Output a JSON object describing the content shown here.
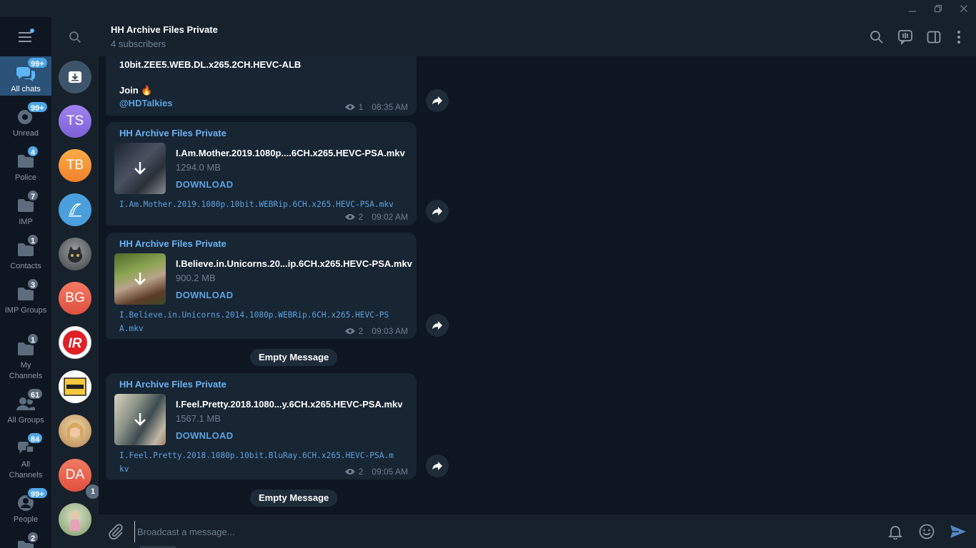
{
  "window": {
    "controls": [
      "minimize-icon",
      "restore-icon",
      "close-icon"
    ]
  },
  "sidebar": {
    "menu_icon": "hamburger-icon",
    "folders": [
      {
        "label": "All chats",
        "badge": "99+",
        "badge_style": "accent",
        "icon": "chats-icon",
        "active": true
      },
      {
        "label": "Unread",
        "badge": "99+",
        "badge_style": "accent",
        "icon": "unread-icon"
      },
      {
        "label": "Police",
        "badge": "4",
        "badge_style": "accent",
        "icon": "folder-icon"
      },
      {
        "label": "IMP",
        "badge": "7",
        "badge_style": "muted",
        "icon": "folder-icon"
      },
      {
        "label": "Contacts",
        "badge": "1",
        "badge_style": "muted",
        "icon": "folder-icon"
      },
      {
        "label": "IMP Groups",
        "badge": "3",
        "badge_style": "muted",
        "icon": "folder-icon"
      },
      {
        "label": "My Channels",
        "badge": "1",
        "badge_style": "muted",
        "icon": "folder-icon"
      },
      {
        "label": "All Groups",
        "badge": "61",
        "badge_style": "muted",
        "icon": "groups-icon"
      },
      {
        "label": "All Channels",
        "badge": "84",
        "badge_style": "accent",
        "icon": "channels-icon"
      },
      {
        "label": "People",
        "badge": "99+",
        "badge_style": "accent",
        "icon": "person-icon"
      },
      {
        "label": "",
        "badge": "2",
        "badge_style": "muted",
        "icon": "folder-icon"
      }
    ]
  },
  "chatlist": {
    "search_icon": "search-icon",
    "avatars": [
      {
        "name": "archive",
        "initials": "",
        "color": "#3e546a"
      },
      {
        "name": "ts",
        "initials": "TS",
        "color": "#8e70e0"
      },
      {
        "name": "tb",
        "initials": "TB",
        "color": "#f2933a"
      },
      {
        "name": "logo-blue",
        "initials": "",
        "color": "#4a9fdc"
      },
      {
        "name": "photo-cat",
        "initials": "",
        "color": "#6a6e72"
      },
      {
        "name": "bg",
        "initials": "BG",
        "color": "#e75c4a"
      },
      {
        "name": "ir-logo",
        "initials": "",
        "color": "#ffffff"
      },
      {
        "name": "offer-box",
        "initials": "",
        "color": "#f7c93e"
      },
      {
        "name": "photo-woman",
        "initials": "",
        "color": "#c69a6a"
      },
      {
        "name": "da",
        "initials": "DA",
        "color": "#e75c4a",
        "badge": "1"
      },
      {
        "name": "photo-child",
        "initials": "",
        "color": "#9cb47e"
      }
    ]
  },
  "header": {
    "title": "HH Archive Files Private",
    "subtitle": "4 subscribers",
    "icons": [
      "search-icon",
      "live-stream-icon",
      "sidebar-toggle-icon",
      "more-vert-icon"
    ]
  },
  "messages": {
    "first": {
      "line1": "10bit.ZEE5.WEB.DL.x265.2CH.HEVC-ALB",
      "join": "Join 🔥",
      "mention": "@HDTalkies",
      "views": "1",
      "time": "08:35 AM"
    },
    "files": [
      {
        "sender": "HH Archive Files Private",
        "file_name": "I.Am.Mother.2019.1080p....6CH.x265.HEVC-PSA.mkv",
        "file_size": "1294.0 MB",
        "download_label": "DOWNLOAD",
        "caption": "I.Am.Mother.2019.1080p.10bit.WEBRip.6CH.x265.HEVC-PSA.mkv",
        "views": "2",
        "time": "09:02 AM"
      },
      {
        "sender": "HH Archive Files Private",
        "file_name": "I.Believe.in.Unicorns.20...ip.6CH.x265.HEVC-PSA.mkv",
        "file_size": "900.2 MB",
        "download_label": "DOWNLOAD",
        "caption": "I.Believe.in.Unicorns.2014.1080p.WEBRip.6CH.x265.HEVC-PSA.mkv",
        "views": "2",
        "time": "09:03 AM"
      },
      {
        "sender": "HH Archive Files Private",
        "file_name": "I.Feel.Pretty.2018.1080...y.6CH.x265.HEVC-PSA.mkv",
        "file_size": "1567.1 MB",
        "download_label": "DOWNLOAD",
        "caption": "I.Feel.Pretty.2018.1080p.10bit.BluRay.6CH.x265.HEVC-PSA.mkv",
        "views": "2",
        "time": "09:05 AM"
      }
    ],
    "service_1": "Empty Message",
    "service_2": "Empty Message"
  },
  "composer": {
    "placeholder": "Broadcast a message...",
    "value": "",
    "icons": [
      "attach-icon",
      "bell-icon",
      "emoji-icon",
      "send-icon"
    ]
  },
  "colors": {
    "accent": "#5ca3df",
    "bg": "#0e1621",
    "panel": "#17212b",
    "bubble": "#182533",
    "active_folder": "#2b5278"
  }
}
